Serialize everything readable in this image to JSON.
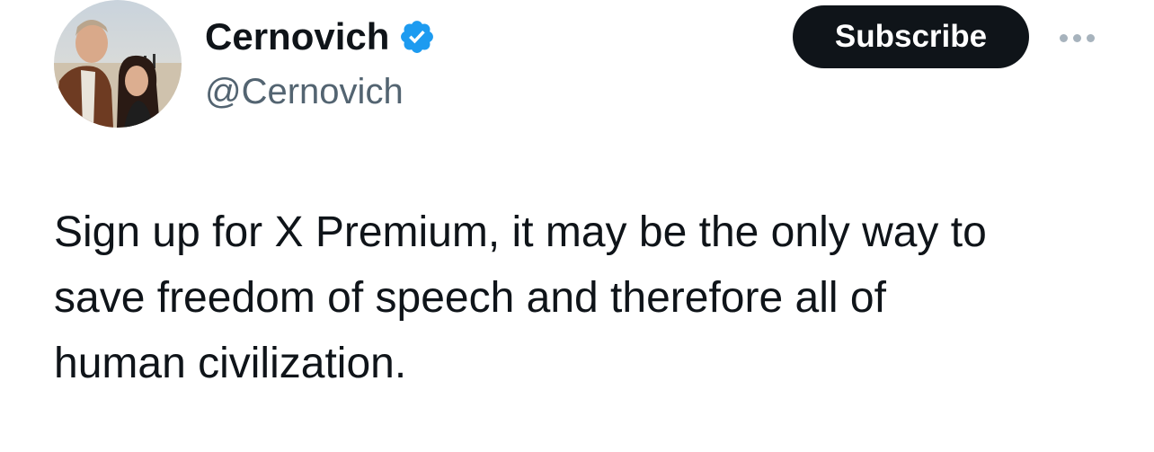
{
  "author": {
    "display_name": "Cernovich",
    "handle": "@Cernovich",
    "verified": true,
    "avatar_icon": "profile-photo"
  },
  "actions": {
    "subscribe_label": "Subscribe",
    "more_icon": "more-horizontal-icon"
  },
  "tweet": {
    "text": "Sign up for X Premium, it may be the only way to\nsave freedom of speech and therefore all of\nhuman civilization."
  },
  "colors": {
    "text_primary": "#0f1419",
    "text_secondary": "#536471",
    "verified_blue": "#1d9bf0",
    "button_bg": "#0f1419"
  }
}
